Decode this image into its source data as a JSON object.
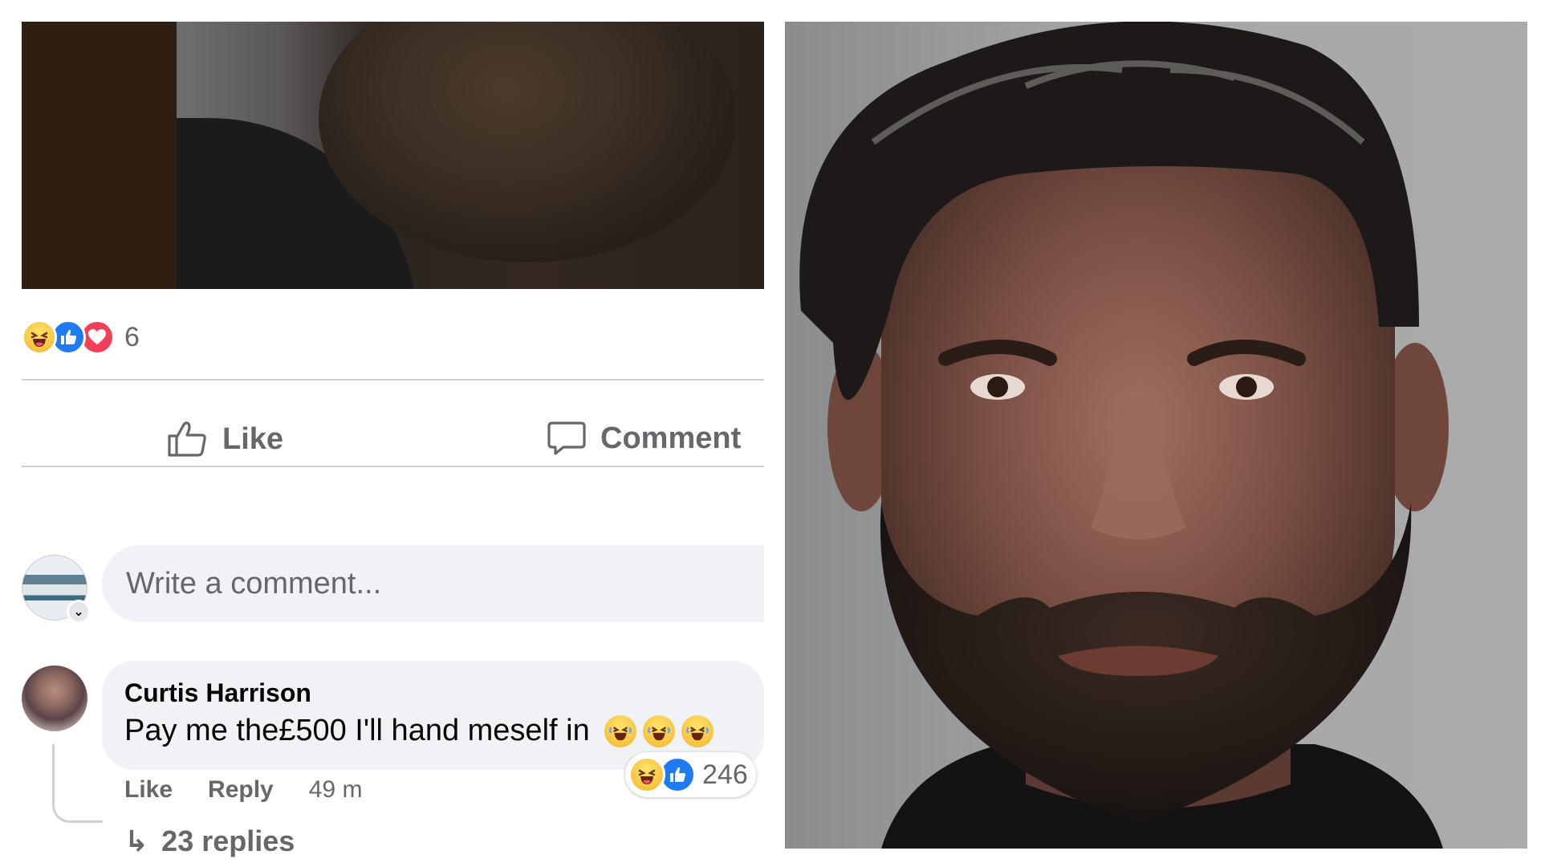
{
  "post": {
    "reaction_icons": [
      "haha-icon",
      "like-icon",
      "love-icon"
    ],
    "reaction_count": "6"
  },
  "actions": {
    "like_label": "Like",
    "comment_label": "Comment"
  },
  "composer": {
    "placeholder": "Write a comment..."
  },
  "comment": {
    "author": "Curtis Harrison",
    "text": "Pay me the£500 I'll hand meself in",
    "emojis": [
      "laughing-icon",
      "laughing-icon",
      "laughing-icon"
    ],
    "reaction_icons": [
      "haha-icon",
      "like-icon"
    ],
    "reaction_count": "246",
    "like_label": "Like",
    "reply_label": "Reply",
    "timestamp": "49 m",
    "replies_label": "23 replies"
  },
  "colors": {
    "meta_gray": "#65676b",
    "bubble_bg": "#f0f2f5",
    "divider": "#ced0d4",
    "like_blue": "#1f7bf2",
    "love_red": "#f33e58",
    "haha_yellow": "#f3b52a"
  }
}
